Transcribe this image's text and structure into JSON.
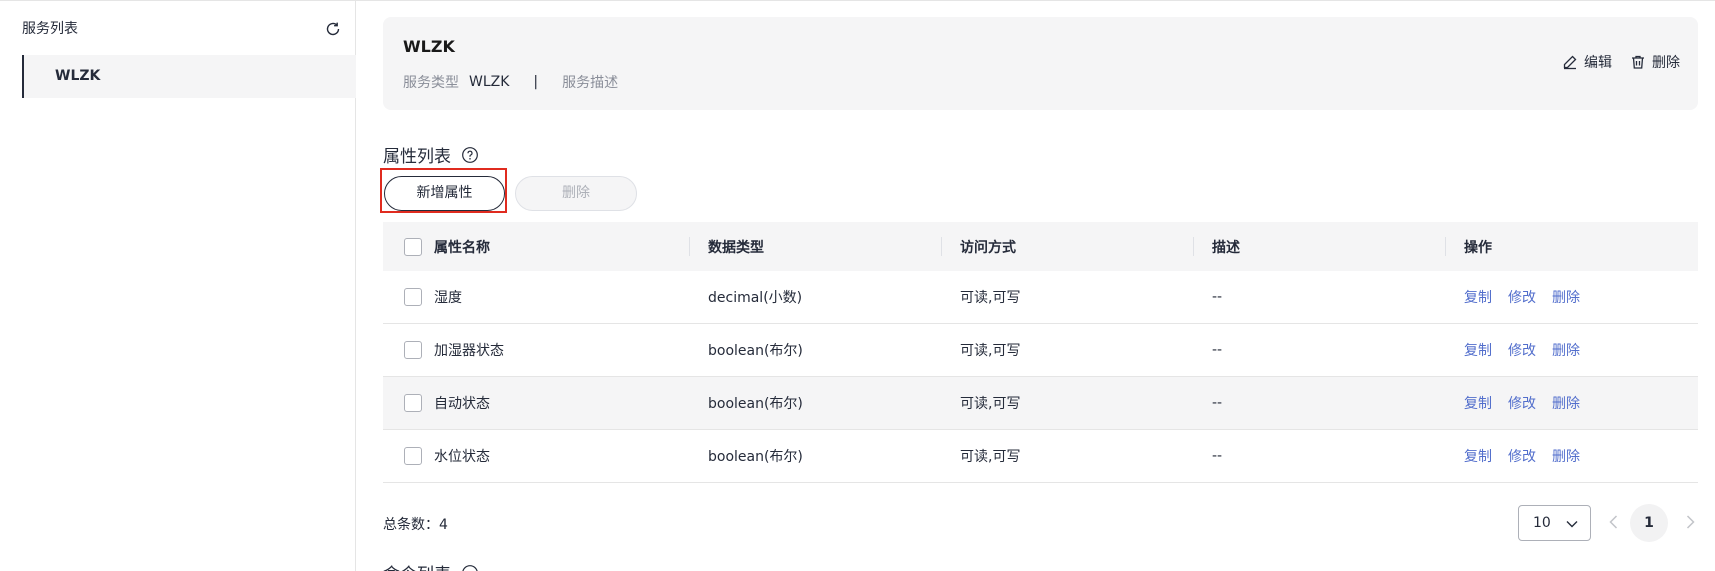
{
  "sidebar": {
    "title": "服务列表",
    "items": [
      {
        "label": "WLZK"
      }
    ]
  },
  "service": {
    "name": "WLZK",
    "type_label": "服务类型",
    "type_value": "WLZK",
    "separator": "|",
    "desc_label": "服务描述",
    "edit_label": "编辑",
    "delete_label": "删除"
  },
  "properties": {
    "title": "属性列表",
    "add_button": "新增属性",
    "delete_button": "删除",
    "columns": [
      "属性名称",
      "数据类型",
      "访问方式",
      "描述",
      "操作"
    ],
    "rows": [
      {
        "name": "湿度",
        "type": "decimal(小数)",
        "access": "可读,可写",
        "desc": "--"
      },
      {
        "name": "加湿器状态",
        "type": "boolean(布尔)",
        "access": "可读,可写",
        "desc": "--"
      },
      {
        "name": "自动状态",
        "type": "boolean(布尔)",
        "access": "可读,可写",
        "desc": "--"
      },
      {
        "name": "水位状态",
        "type": "boolean(布尔)",
        "access": "可读,可写",
        "desc": "--"
      }
    ],
    "actions": {
      "copy": "复制",
      "modify": "修改",
      "delete": "删除"
    }
  },
  "pagination": {
    "total_text": "总条数：4",
    "page_size": "10",
    "current_page": "1"
  },
  "commands": {
    "title": "命令列表"
  }
}
